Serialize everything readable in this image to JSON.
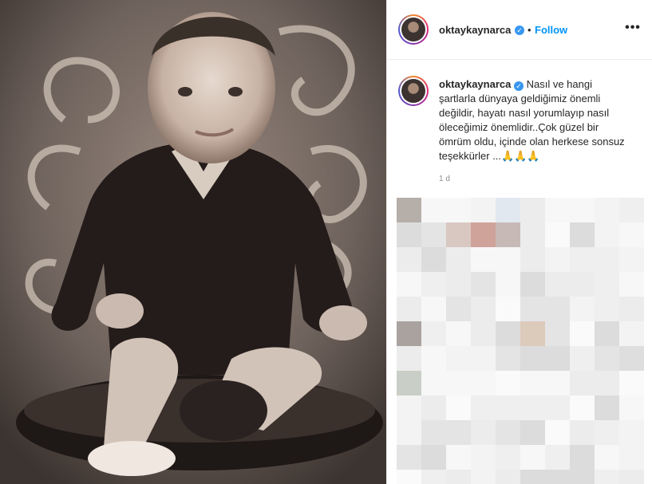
{
  "post": {
    "username": "oktaykaynarca",
    "verified_mark": "✓",
    "separator": "•",
    "follow_label": "Follow",
    "more_label": "•••",
    "caption_username": "oktaykaynarca",
    "caption": "Nasıl ve hangi şartlarla dünyaya geldiğimiz önemli değildir, hayatı nasıl yorumlayıp nasıl öleceğimiz önemlidir..Çok güzel bir ömrüm oldu, içinde olan herkese sonsuz teşekkürler ...🙏🙏🙏",
    "timestamp": "1 d"
  },
  "icons": {
    "verified": "verified-badge-icon",
    "more": "more-options-icon"
  },
  "colors": {
    "follow": "#0095f6",
    "verified": "#3897f0",
    "photo_tone": "#2b2420"
  }
}
